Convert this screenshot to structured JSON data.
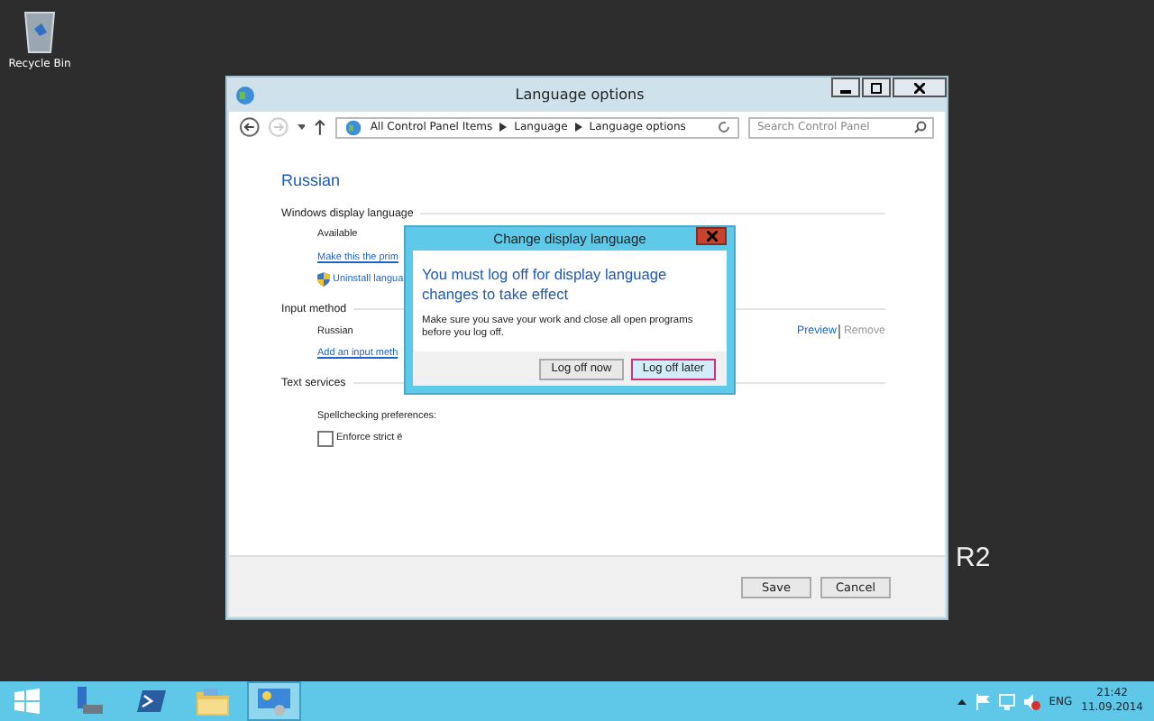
{
  "desktop": {
    "icons": [
      {
        "label": "Recycle Bin"
      }
    ],
    "branding": "R2"
  },
  "window": {
    "title": "Language options",
    "breadcrumb": [
      "All Control Panel Items",
      "Language",
      "Language options"
    ],
    "search": {
      "placeholder": "Search Control Panel"
    },
    "language": "Russian",
    "sections": [
      {
        "title": "Windows display language",
        "items": [
          {
            "kind": "text",
            "text": "Available"
          },
          {
            "kind": "link",
            "text": "Make this the prim"
          },
          {
            "kind": "shield-link",
            "text": "Uninstall langua"
          }
        ]
      },
      {
        "title": "Input method",
        "items": [
          {
            "kind": "method",
            "text": "Russian",
            "actions": [
              {
                "label": "Preview",
                "disabled": false
              },
              {
                "label": "Remove",
                "disabled": true
              }
            ]
          },
          {
            "kind": "link",
            "text": "Add an input meth"
          }
        ]
      },
      {
        "title": "Text services",
        "items": [
          {
            "kind": "text",
            "text": "Spellchecking preferences:"
          },
          {
            "kind": "checkbox",
            "text": "Enforce strict ё",
            "checked": false
          }
        ]
      }
    ],
    "buttons": [
      "Save",
      "Cancel"
    ]
  },
  "dialog": {
    "title": "Change display language",
    "heading": "You must log off for display language changes to take effect",
    "message": "Make sure you save your work and close all open programs before you log off.",
    "buttons": [
      {
        "label": "Log off now",
        "selected": false
      },
      {
        "label": "Log off later",
        "selected": true
      }
    ]
  },
  "taskbar": {
    "apps": [
      {
        "kind": "server",
        "selected": false
      },
      {
        "kind": "powershell",
        "selected": false
      },
      {
        "kind": "explorer",
        "selected": false
      },
      {
        "kind": "control-panel",
        "selected": true
      }
    ],
    "tray": {
      "language": "ENG",
      "time": "21:42",
      "date": "11.09.2014"
    }
  }
}
